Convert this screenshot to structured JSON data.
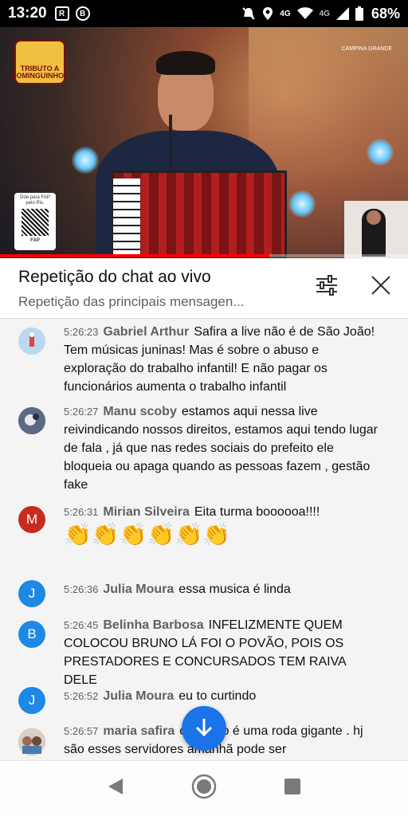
{
  "status_bar": {
    "time": "13:20",
    "app_icons": [
      "R",
      "B"
    ],
    "network": "4G",
    "network2": "4G",
    "battery": "68%"
  },
  "video": {
    "logo_text": "TRIBUTO A DOMINGUINHOS",
    "pix_text": "Doe para FAP pelo Pix.",
    "pix_brand": "FAP",
    "sponsor_text": "CAMPINA GRANDE",
    "progress_percent": 66
  },
  "chat_header": {
    "title": "Repetição do chat ao vivo",
    "subtitle": "Repetição das principais mensagen..."
  },
  "messages": [
    {
      "time": "5:26:23",
      "author": "Gabriel Arthur",
      "text": "Safira a live não é de São João! Tem músicas juninas! Mas é sobre o abuso e exploração do trabalho infantil! E não pagar os funcionários aumenta o trabalho infantil",
      "avatar_letter": "",
      "avatar_color": "#bcd8ee"
    },
    {
      "time": "5:26:27",
      "author": "Manu scoby",
      "text": "estamos aqui nessa live reivindicando nossos direitos, estamos aqui tendo lugar de fala , já que nas redes sociais do prefeito ele bloqueia ou apaga quando as pessoas fazem , gestão fake",
      "avatar_letter": "",
      "avatar_color": "#5a6a85"
    },
    {
      "time": "5:26:31",
      "author": "Mirian Silveira",
      "text": "Eita turma boooooa!!!!",
      "emojis": "👏👏👏👏👏👏",
      "avatar_letter": "M",
      "avatar_color": "#c62d1f"
    },
    {
      "time": "5:26:36",
      "author": "Julia Moura",
      "text": "essa musica é linda",
      "avatar_letter": "J",
      "avatar_color": "#1e88e5"
    },
    {
      "time": "5:26:45",
      "author": "Belinha Barbosa",
      "text": "INFELIZMENTE QUEM COLOCOU BRUNO LÁ FOI O POVÃO, POIS OS PRESTADORES E CONCURSADOS TEM RAIVA DELE",
      "avatar_letter": "B",
      "avatar_color": "#1e88e5"
    },
    {
      "time": "5:26:52",
      "author": "Julia Moura",
      "text": "eu to curtindo",
      "avatar_letter": "J",
      "avatar_color": "#1e88e5"
    },
    {
      "time": "5:26:57",
      "author": "maria safira",
      "text": "o mundo é uma roda gigante . hj são esses servidores amanhã pode ser",
      "avatar_letter": "",
      "avatar_color": "#8a6a58"
    }
  ],
  "colors": {
    "accent": "#1a73e8",
    "progress": "#ff0000"
  },
  "icons": {
    "filter": "sliders-icon",
    "close": "close-icon",
    "scroll_down": "arrow-down-icon",
    "back": "back-triangle-icon",
    "home": "home-circle-icon",
    "recents": "recents-square-icon"
  }
}
